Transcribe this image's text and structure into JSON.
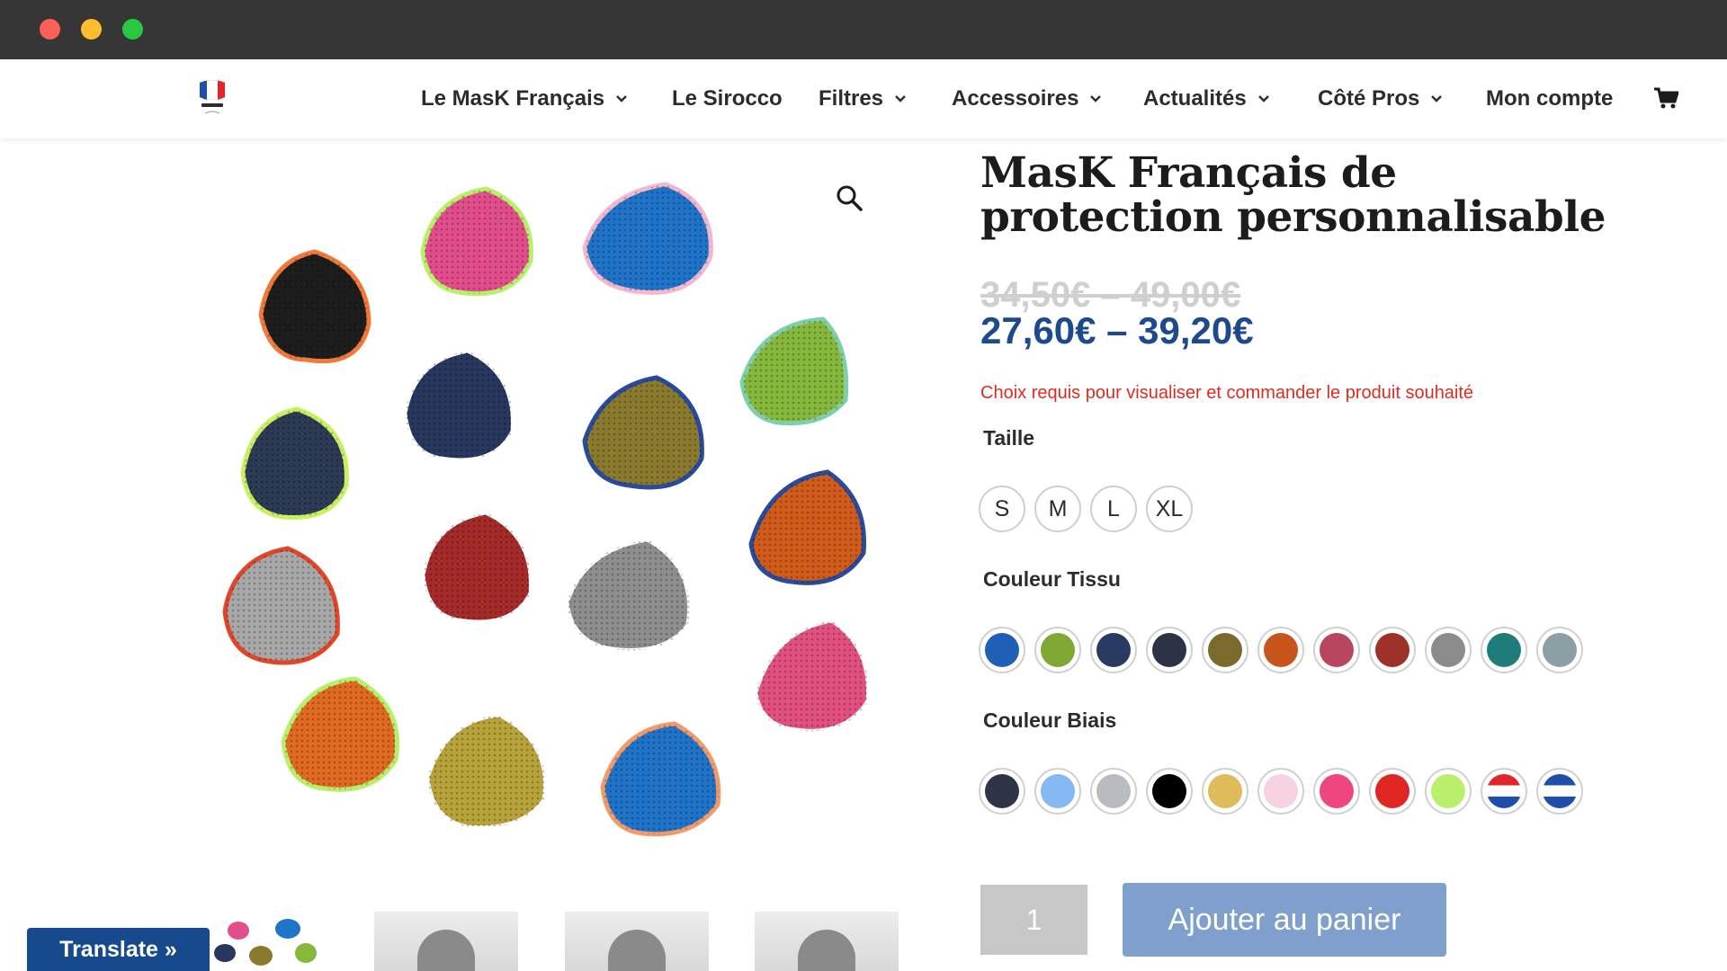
{
  "nav": {
    "items": [
      {
        "label": "Le MasK Français",
        "has_dropdown": true
      },
      {
        "label": "Le Sirocco",
        "has_dropdown": false
      },
      {
        "label": "Filtres",
        "has_dropdown": true
      },
      {
        "label": "Accessoires",
        "has_dropdown": true
      },
      {
        "label": "Actualités",
        "has_dropdown": true
      },
      {
        "label": "Côté Pros",
        "has_dropdown": true
      },
      {
        "label": "Mon compte",
        "has_dropdown": false
      }
    ],
    "cart_icon": "cart-icon"
  },
  "product": {
    "title": "MasK Français de protection personnalisable",
    "old_price": "34,50€ – 49,00€",
    "new_price": "27,60€ – 39,20€",
    "notice": "Choix requis pour visualiser et commander le produit souhaité",
    "size_label": "Taille",
    "sizes": [
      "S",
      "M",
      "L",
      "XL"
    ],
    "fabric_label": "Couleur Tissu",
    "fabric_colors": [
      "#1f5fb5",
      "#7fa835",
      "#2a3b63",
      "#2b3344",
      "#7a6a2c",
      "#c9541b",
      "#b8465f",
      "#9e3228",
      "#8c8c8c",
      "#1f7d79",
      "#8aa0a4"
    ],
    "trim_label": "Couleur Biais",
    "trim_colors": [
      "#2e3548",
      "#86b8f2",
      "#b8bcc0",
      "#000000",
      "#e0bb5a",
      "#f7d3e2",
      "#f0467f",
      "#e02623",
      "#b8f06b",
      "flag-nl",
      "flag-blue-white"
    ],
    "quantity": "1",
    "add_to_cart": "Ajouter au panier"
  },
  "translate": {
    "label": "Translate »"
  },
  "colors": {
    "accent_blue": "#1c4a8c",
    "notice_red": "#e02b20",
    "button_blue": "#7fa0cd"
  }
}
